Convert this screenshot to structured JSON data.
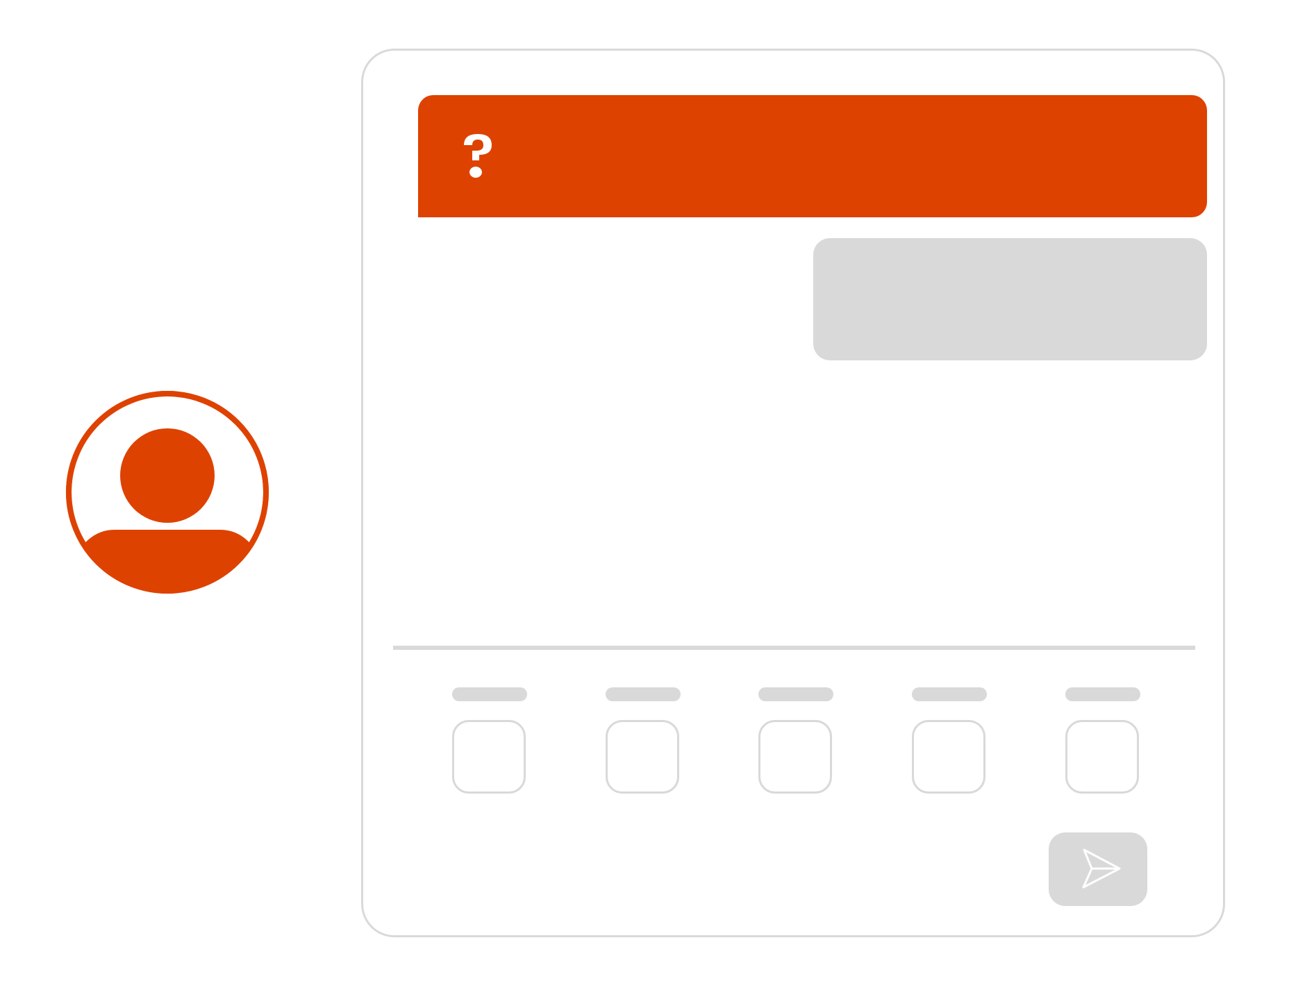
{
  "colors": {
    "accent": "#de4200",
    "placeholder_gray": "#d9d9d9",
    "background": "#ffffff"
  },
  "avatar": {
    "icon": "user-avatar-icon"
  },
  "question_banner": {
    "icon": "question-mark-icon",
    "text": ""
  },
  "reply_box": {
    "text": ""
  },
  "options": [
    {
      "label": "",
      "checked": false
    },
    {
      "label": "",
      "checked": false
    },
    {
      "label": "",
      "checked": false
    },
    {
      "label": "",
      "checked": false
    },
    {
      "label": "",
      "checked": false
    }
  ],
  "send_button": {
    "icon": "send-icon"
  }
}
